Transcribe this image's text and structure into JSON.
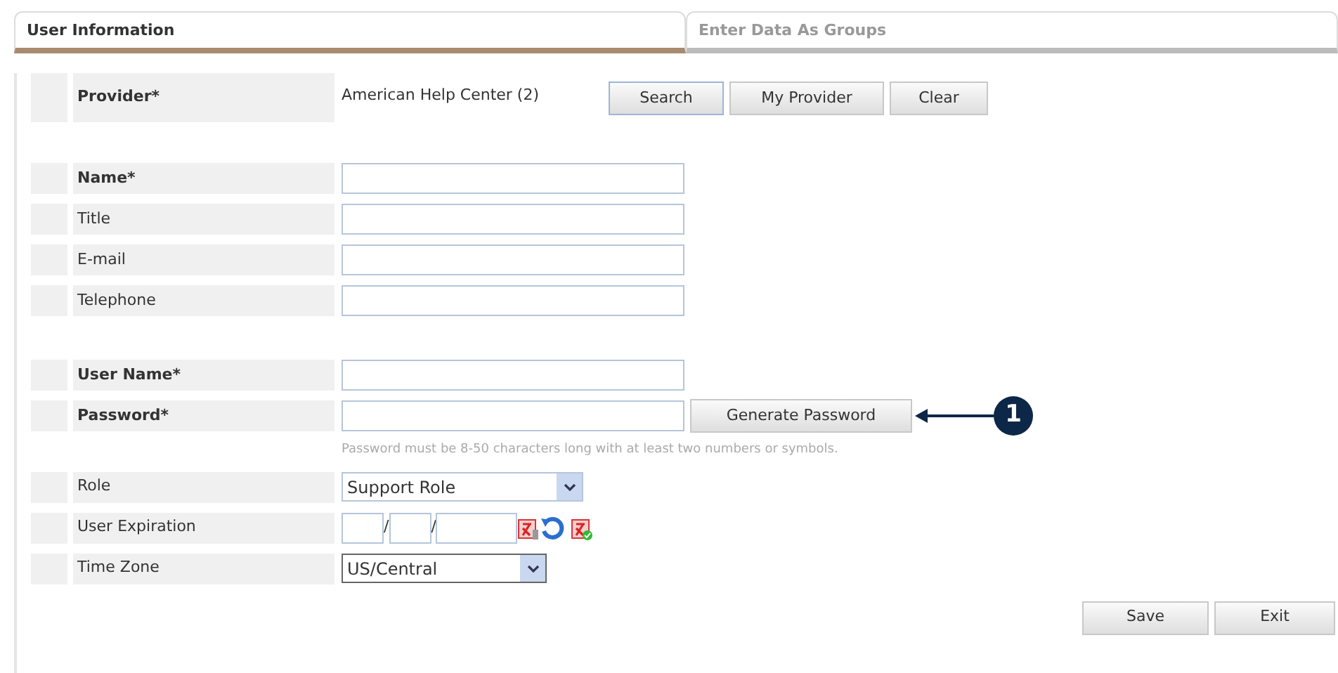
{
  "tabs": [
    {
      "label": "User Information",
      "selected": true
    },
    {
      "label": "Enter Data As Groups",
      "selected": false
    }
  ],
  "provider": {
    "label": "Provider*",
    "required": true,
    "value": "American Help Center (2)",
    "buttons": [
      {
        "label": "Search",
        "focused": true
      },
      {
        "label": "My Provider",
        "focused": false
      },
      {
        "label": "Clear",
        "focused": false
      }
    ]
  },
  "groups": [
    [
      {
        "kind": "text",
        "label": "Name*",
        "required": true
      },
      {
        "kind": "text",
        "label": "Title",
        "required": false
      },
      {
        "kind": "text",
        "label": "E-mail",
        "required": false
      },
      {
        "kind": "text",
        "label": "Telephone",
        "required": false
      }
    ],
    [
      {
        "kind": "text",
        "label": "User Name*",
        "required": true
      },
      {
        "kind": "password",
        "label": "Password*",
        "required": true,
        "button": "Generate Password",
        "hint": "Password must be 8-50 characters long with at least two numbers or symbols.",
        "callout": "1"
      },
      {
        "kind": "select",
        "label": "Role",
        "required": false,
        "value": "Support Role",
        "wide": true
      },
      {
        "kind": "date",
        "label": "User Expiration",
        "required": false,
        "separators": [
          "/",
          "/"
        ]
      },
      {
        "kind": "select",
        "label": "Time Zone",
        "required": false,
        "value": "US/Central",
        "wide": false
      }
    ]
  ],
  "actions": [
    "Save",
    "Exit"
  ]
}
